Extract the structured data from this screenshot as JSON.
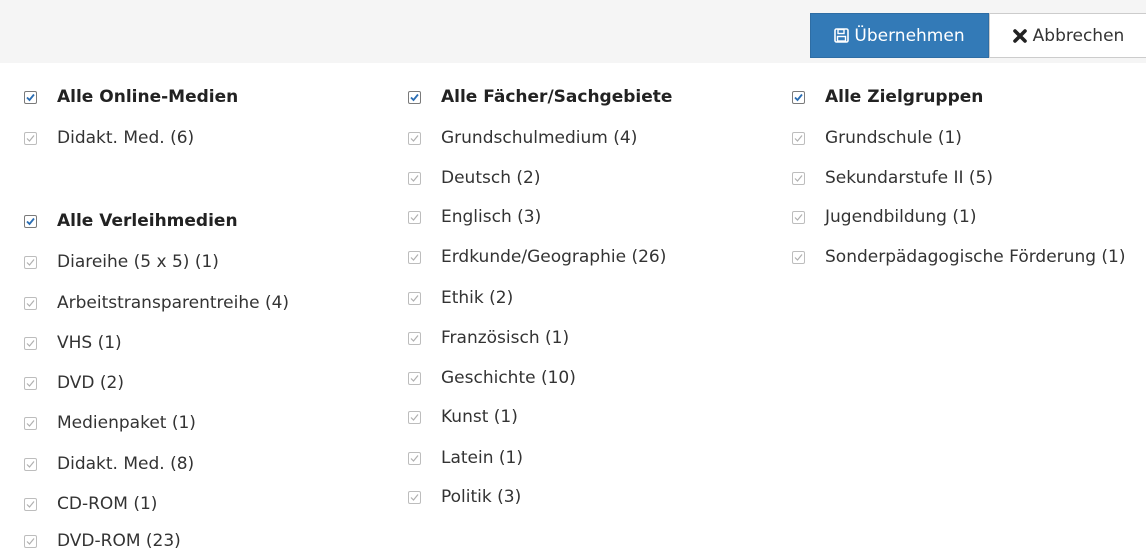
{
  "toolbar": {
    "apply_label": "Übernehmen",
    "cancel_label": "Abbrechen",
    "apply_icon": "save-icon",
    "cancel_icon": "close-icon",
    "primary_color": "#337ab7"
  },
  "columns": {
    "media": {
      "online": {
        "header": "Alle Online-Medien",
        "items": [
          "Didakt. Med. (6)"
        ]
      },
      "loan": {
        "header": "Alle Verleihmedien",
        "items": [
          "Diareihe (5 x 5) (1)",
          "Arbeitstransparentreihe (4)",
          "VHS (1)",
          "DVD (2)",
          "Medienpaket (1)",
          "Didakt. Med. (8)",
          "CD-ROM (1)",
          "DVD-ROM (23)"
        ]
      }
    },
    "subjects": {
      "header": "Alle Fächer/Sachgebiete",
      "items": [
        "Grundschulmedium (4)",
        "Deutsch (2)",
        "Englisch (3)",
        "Erdkunde/Geographie (26)",
        "Ethik (2)",
        "Französisch (1)",
        "Geschichte (10)",
        "Kunst (1)",
        "Latein (1)",
        "Politik (3)"
      ]
    },
    "audiences": {
      "header": "Alle Zielgruppen",
      "items": [
        "Grundschule (1)",
        "Sekundarstufe II (5)",
        "Jugendbildung (1)",
        "Sonderpädagogische Förderung (1)"
      ]
    }
  }
}
